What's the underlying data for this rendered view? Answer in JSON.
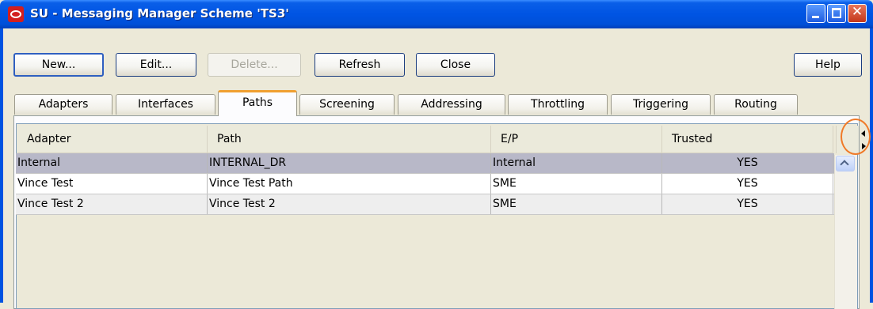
{
  "window": {
    "title": "SU - Messaging Manager Scheme 'TS3'",
    "controls": [
      "minimize-icon",
      "maximize-icon",
      "close-icon"
    ],
    "close_glyph": "✕"
  },
  "toolbar": {
    "new_label": "New...",
    "edit_label": "Edit...",
    "delete_label": "Delete...",
    "refresh_label": "Refresh",
    "close_label": "Close",
    "help_label": "Help"
  },
  "tabs": [
    {
      "label": "Adapters"
    },
    {
      "label": "Interfaces"
    },
    {
      "label": "Paths",
      "active": true
    },
    {
      "label": "Screening"
    },
    {
      "label": "Addressing"
    },
    {
      "label": "Throttling"
    },
    {
      "label": "Triggering"
    },
    {
      "label": "Routing"
    }
  ],
  "table": {
    "columns": [
      "Adapter",
      "Path",
      "E/P",
      "Trusted"
    ],
    "rows": [
      {
        "adapter": "Internal",
        "path": "INTERNAL_DR",
        "ep": "Internal",
        "trusted": "YES",
        "selected": true
      },
      {
        "adapter": "Vince Test",
        "path": "Vince Test Path",
        "ep": "SME",
        "trusted": "YES"
      },
      {
        "adapter": "Vince Test 2",
        "path": "Vince Test 2",
        "ep": "SME",
        "trusted": "YES"
      }
    ]
  },
  "colors": {
    "titlebar": "#0054E3",
    "selected_row": "#B8B8C8",
    "active_tab_accent": "#F0A030",
    "highlight_circle": "#F07A28"
  }
}
